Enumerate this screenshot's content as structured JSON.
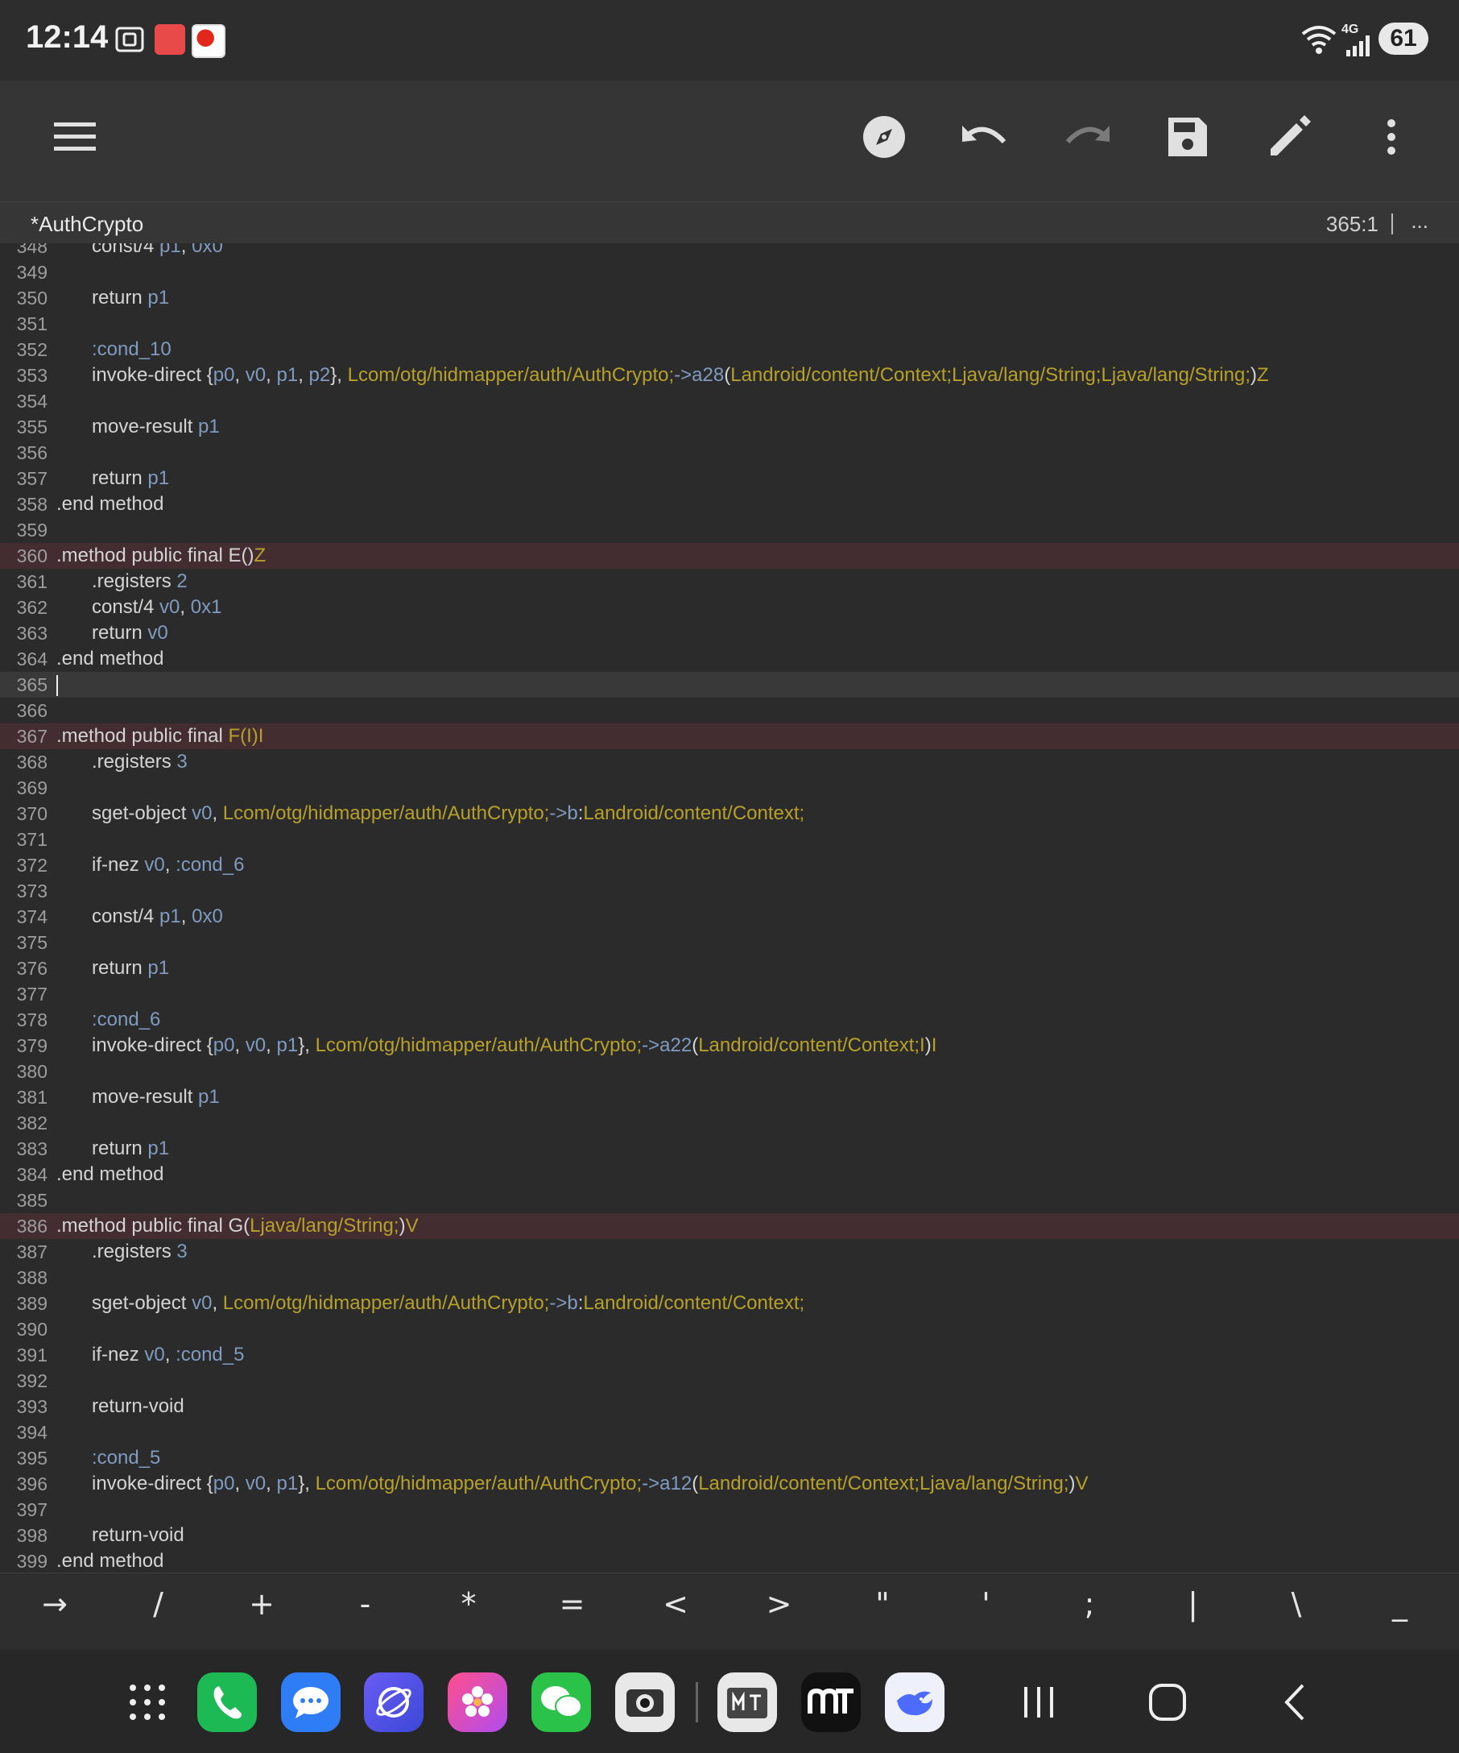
{
  "status": {
    "time": "12:14",
    "network": "4G",
    "battery": "61"
  },
  "editor": {
    "file_title": "*AuthCrypto",
    "cursor_position": "365:1",
    "more_label": "..."
  },
  "toolbar": {
    "icons": [
      "menu-icon",
      "compass-icon",
      "undo-icon",
      "redo-icon",
      "save-icon",
      "edit-icon",
      "more-vert-icon"
    ]
  },
  "code_lines": [
    {
      "n": "348",
      "hl": "",
      "parts": [
        [
          "i",
          ""
        ],
        [
          "k",
          "const/4 "
        ],
        [
          "r",
          "p1"
        ],
        [
          "k",
          ", "
        ],
        [
          "r",
          "0x0"
        ]
      ]
    },
    {
      "n": "349",
      "hl": "",
      "parts": []
    },
    {
      "n": "350",
      "hl": "",
      "parts": [
        [
          "i",
          ""
        ],
        [
          "k",
          "return "
        ],
        [
          "r",
          "p1"
        ]
      ]
    },
    {
      "n": "351",
      "hl": "",
      "parts": []
    },
    {
      "n": "352",
      "hl": "",
      "parts": [
        [
          "i",
          ""
        ],
        [
          "lb",
          ":cond_10"
        ]
      ]
    },
    {
      "n": "353",
      "hl": "",
      "parts": [
        [
          "i",
          ""
        ],
        [
          "k",
          "invoke-direct {"
        ],
        [
          "r",
          "p0"
        ],
        [
          "k",
          ", "
        ],
        [
          "r",
          "v0"
        ],
        [
          "k",
          ", "
        ],
        [
          "r",
          "p1"
        ],
        [
          "k",
          ", "
        ],
        [
          "r",
          "p2"
        ],
        [
          "k",
          "}, "
        ],
        [
          "t",
          "Lcom/otg/hidmapper/auth/AuthCrypto;"
        ],
        [
          "m",
          "->a28"
        ],
        [
          "k",
          "("
        ],
        [
          "t",
          "Landroid/content/Context;Ljava/lang/String;Ljava/lang/String;"
        ],
        [
          "k",
          ")"
        ],
        [
          "t",
          "Z"
        ]
      ]
    },
    {
      "n": "354",
      "hl": "",
      "parts": []
    },
    {
      "n": "355",
      "hl": "",
      "parts": [
        [
          "i",
          ""
        ],
        [
          "k",
          "move-result "
        ],
        [
          "r",
          "p1"
        ]
      ]
    },
    {
      "n": "356",
      "hl": "",
      "parts": []
    },
    {
      "n": "357",
      "hl": "",
      "parts": [
        [
          "i",
          ""
        ],
        [
          "k",
          "return "
        ],
        [
          "r",
          "p1"
        ]
      ]
    },
    {
      "n": "358",
      "hl": "",
      "parts": [
        [
          "k",
          ".end method"
        ]
      ]
    },
    {
      "n": "359",
      "hl": "",
      "parts": []
    },
    {
      "n": "360",
      "hl": "method",
      "parts": [
        [
          "k",
          ".method public final E()"
        ],
        [
          "t",
          "Z"
        ]
      ]
    },
    {
      "n": "361",
      "hl": "",
      "parts": [
        [
          "i",
          ""
        ],
        [
          "k",
          ".registers "
        ],
        [
          "r",
          "2"
        ]
      ]
    },
    {
      "n": "362",
      "hl": "",
      "parts": [
        [
          "i",
          ""
        ],
        [
          "k",
          "const/4 "
        ],
        [
          "r",
          "v0"
        ],
        [
          "k",
          ", "
        ],
        [
          "r",
          "0x1"
        ]
      ]
    },
    {
      "n": "363",
      "hl": "",
      "parts": [
        [
          "i",
          ""
        ],
        [
          "k",
          "return "
        ],
        [
          "r",
          "v0"
        ]
      ]
    },
    {
      "n": "364",
      "hl": "",
      "parts": [
        [
          "k",
          ".end method"
        ]
      ]
    },
    {
      "n": "365",
      "hl": "current",
      "parts": [
        [
          "c",
          ""
        ]
      ]
    },
    {
      "n": "366",
      "hl": "",
      "parts": []
    },
    {
      "n": "367",
      "hl": "method",
      "parts": [
        [
          "k",
          ".method public final "
        ],
        [
          "t",
          "F(I)I"
        ]
      ]
    },
    {
      "n": "368",
      "hl": "",
      "parts": [
        [
          "i",
          ""
        ],
        [
          "k",
          ".registers "
        ],
        [
          "r",
          "3"
        ]
      ]
    },
    {
      "n": "369",
      "hl": "",
      "parts": []
    },
    {
      "n": "370",
      "hl": "",
      "parts": [
        [
          "i",
          ""
        ],
        [
          "k",
          "sget-object "
        ],
        [
          "r",
          "v0"
        ],
        [
          "k",
          ", "
        ],
        [
          "t",
          "Lcom/otg/hidmapper/auth/AuthCrypto;"
        ],
        [
          "m",
          "->b"
        ],
        [
          "k",
          ":"
        ],
        [
          "t",
          "Landroid/content/Context;"
        ]
      ]
    },
    {
      "n": "371",
      "hl": "",
      "parts": []
    },
    {
      "n": "372",
      "hl": "",
      "parts": [
        [
          "i",
          ""
        ],
        [
          "k",
          "if-nez "
        ],
        [
          "r",
          "v0"
        ],
        [
          "k",
          ", "
        ],
        [
          "lb",
          ":cond_6"
        ]
      ]
    },
    {
      "n": "373",
      "hl": "",
      "parts": []
    },
    {
      "n": "374",
      "hl": "",
      "parts": [
        [
          "i",
          ""
        ],
        [
          "k",
          "const/4 "
        ],
        [
          "r",
          "p1"
        ],
        [
          "k",
          ", "
        ],
        [
          "r",
          "0x0"
        ]
      ]
    },
    {
      "n": "375",
      "hl": "",
      "parts": []
    },
    {
      "n": "376",
      "hl": "",
      "parts": [
        [
          "i",
          ""
        ],
        [
          "k",
          "return "
        ],
        [
          "r",
          "p1"
        ]
      ]
    },
    {
      "n": "377",
      "hl": "",
      "parts": []
    },
    {
      "n": "378",
      "hl": "",
      "parts": [
        [
          "i",
          ""
        ],
        [
          "lb",
          ":cond_6"
        ]
      ]
    },
    {
      "n": "379",
      "hl": "",
      "parts": [
        [
          "i",
          ""
        ],
        [
          "k",
          "invoke-direct {"
        ],
        [
          "r",
          "p0"
        ],
        [
          "k",
          ", "
        ],
        [
          "r",
          "v0"
        ],
        [
          "k",
          ", "
        ],
        [
          "r",
          "p1"
        ],
        [
          "k",
          "}, "
        ],
        [
          "t",
          "Lcom/otg/hidmapper/auth/AuthCrypto;"
        ],
        [
          "m",
          "->a22"
        ],
        [
          "k",
          "("
        ],
        [
          "t",
          "Landroid/content/Context;I"
        ],
        [
          "k",
          ")"
        ],
        [
          "t",
          "I"
        ]
      ]
    },
    {
      "n": "380",
      "hl": "",
      "parts": []
    },
    {
      "n": "381",
      "hl": "",
      "parts": [
        [
          "i",
          ""
        ],
        [
          "k",
          "move-result "
        ],
        [
          "r",
          "p1"
        ]
      ]
    },
    {
      "n": "382",
      "hl": "",
      "parts": []
    },
    {
      "n": "383",
      "hl": "",
      "parts": [
        [
          "i",
          ""
        ],
        [
          "k",
          "return "
        ],
        [
          "r",
          "p1"
        ]
      ]
    },
    {
      "n": "384",
      "hl": "",
      "parts": [
        [
          "k",
          ".end method"
        ]
      ]
    },
    {
      "n": "385",
      "hl": "",
      "parts": []
    },
    {
      "n": "386",
      "hl": "method",
      "parts": [
        [
          "k",
          ".method public final G("
        ],
        [
          "t",
          "Ljava/lang/String;"
        ],
        [
          "k",
          ")"
        ],
        [
          "t",
          "V"
        ]
      ]
    },
    {
      "n": "387",
      "hl": "",
      "parts": [
        [
          "i",
          ""
        ],
        [
          "k",
          ".registers "
        ],
        [
          "r",
          "3"
        ]
      ]
    },
    {
      "n": "388",
      "hl": "",
      "parts": []
    },
    {
      "n": "389",
      "hl": "",
      "parts": [
        [
          "i",
          ""
        ],
        [
          "k",
          "sget-object "
        ],
        [
          "r",
          "v0"
        ],
        [
          "k",
          ", "
        ],
        [
          "t",
          "Lcom/otg/hidmapper/auth/AuthCrypto;"
        ],
        [
          "m",
          "->b"
        ],
        [
          "k",
          ":"
        ],
        [
          "t",
          "Landroid/content/Context;"
        ]
      ]
    },
    {
      "n": "390",
      "hl": "",
      "parts": []
    },
    {
      "n": "391",
      "hl": "",
      "parts": [
        [
          "i",
          ""
        ],
        [
          "k",
          "if-nez "
        ],
        [
          "r",
          "v0"
        ],
        [
          "k",
          ", "
        ],
        [
          "lb",
          ":cond_5"
        ]
      ]
    },
    {
      "n": "392",
      "hl": "",
      "parts": []
    },
    {
      "n": "393",
      "hl": "",
      "parts": [
        [
          "i",
          ""
        ],
        [
          "k",
          "return-void"
        ]
      ]
    },
    {
      "n": "394",
      "hl": "",
      "parts": []
    },
    {
      "n": "395",
      "hl": "",
      "parts": [
        [
          "i",
          ""
        ],
        [
          "lb",
          ":cond_5"
        ]
      ]
    },
    {
      "n": "396",
      "hl": "",
      "parts": [
        [
          "i",
          ""
        ],
        [
          "k",
          "invoke-direct {"
        ],
        [
          "r",
          "p0"
        ],
        [
          "k",
          ", "
        ],
        [
          "r",
          "v0"
        ],
        [
          "k",
          ", "
        ],
        [
          "r",
          "p1"
        ],
        [
          "k",
          "}, "
        ],
        [
          "t",
          "Lcom/otg/hidmapper/auth/AuthCrypto;"
        ],
        [
          "m",
          "->a12"
        ],
        [
          "k",
          "("
        ],
        [
          "t",
          "Landroid/content/Context;Ljava/lang/String;"
        ],
        [
          "k",
          ")"
        ],
        [
          "t",
          "V"
        ]
      ]
    },
    {
      "n": "397",
      "hl": "",
      "parts": []
    },
    {
      "n": "398",
      "hl": "",
      "parts": [
        [
          "i",
          ""
        ],
        [
          "k",
          "return-void"
        ]
      ]
    },
    {
      "n": "399",
      "hl": "",
      "parts": [
        [
          "k",
          ".end method"
        ]
      ]
    }
  ],
  "symbols": [
    "→",
    "/",
    "+",
    "-",
    "*",
    "=",
    "<",
    ">",
    "\"",
    "'",
    ";",
    "|",
    "\\",
    "_"
  ],
  "dock": {
    "apps": [
      "apps-grid-icon",
      "phone-icon",
      "messages-icon",
      "browser-icon",
      "gallery-icon",
      "wechat-icon",
      "camera-icon",
      "mt-manager-icon",
      "mt-icon",
      "deepseek-icon"
    ],
    "nav": [
      "recents-icon",
      "home-icon",
      "back-icon"
    ]
  },
  "colors": {
    "background": "#2b2b2b",
    "keyword": "#d4d4d4",
    "register": "#7f9bc0",
    "type": "#b7a02a",
    "method_highlight": "#432d31"
  }
}
